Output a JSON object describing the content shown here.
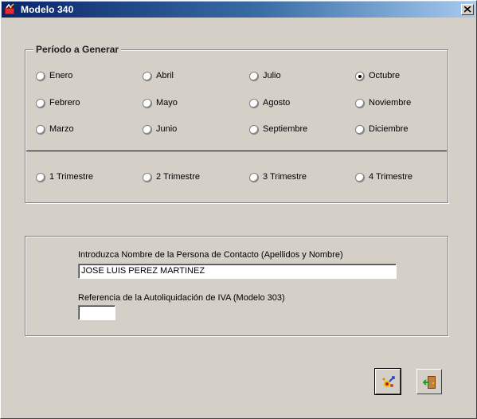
{
  "window": {
    "title": "Modelo 340",
    "icon": "app-icon"
  },
  "periodo": {
    "legend": "Período a Generar",
    "selected": "Octubre",
    "months": [
      {
        "label": "Enero",
        "checked": false
      },
      {
        "label": "Abril",
        "checked": false
      },
      {
        "label": "Julio",
        "checked": false
      },
      {
        "label": "Octubre",
        "checked": true
      },
      {
        "label": "Febrero",
        "checked": false
      },
      {
        "label": "Mayo",
        "checked": false
      },
      {
        "label": "Agosto",
        "checked": false
      },
      {
        "label": "Noviembre",
        "checked": false
      },
      {
        "label": "Marzo",
        "checked": false
      },
      {
        "label": "Junio",
        "checked": false
      },
      {
        "label": "Septiembre",
        "checked": false
      },
      {
        "label": "Diciembre",
        "checked": false
      }
    ],
    "trimestres": [
      {
        "label": "1 Trimestre",
        "checked": false
      },
      {
        "label": "2 Trimestre",
        "checked": false
      },
      {
        "label": "3 Trimestre",
        "checked": false
      },
      {
        "label": "4 Trimestre",
        "checked": false
      }
    ]
  },
  "contacto": {
    "label": "Introduzca Nombre de la Persona de Contacto (Apellidos y Nombre)",
    "value": "JOSE LUIS PEREZ MARTINEZ"
  },
  "referencia": {
    "label": "Referencia de la Autoliquidación de IVA (Modelo 303)",
    "value": ""
  },
  "buttons": {
    "generate_icon": "generate-icon",
    "exit_icon": "exit-door-icon"
  }
}
